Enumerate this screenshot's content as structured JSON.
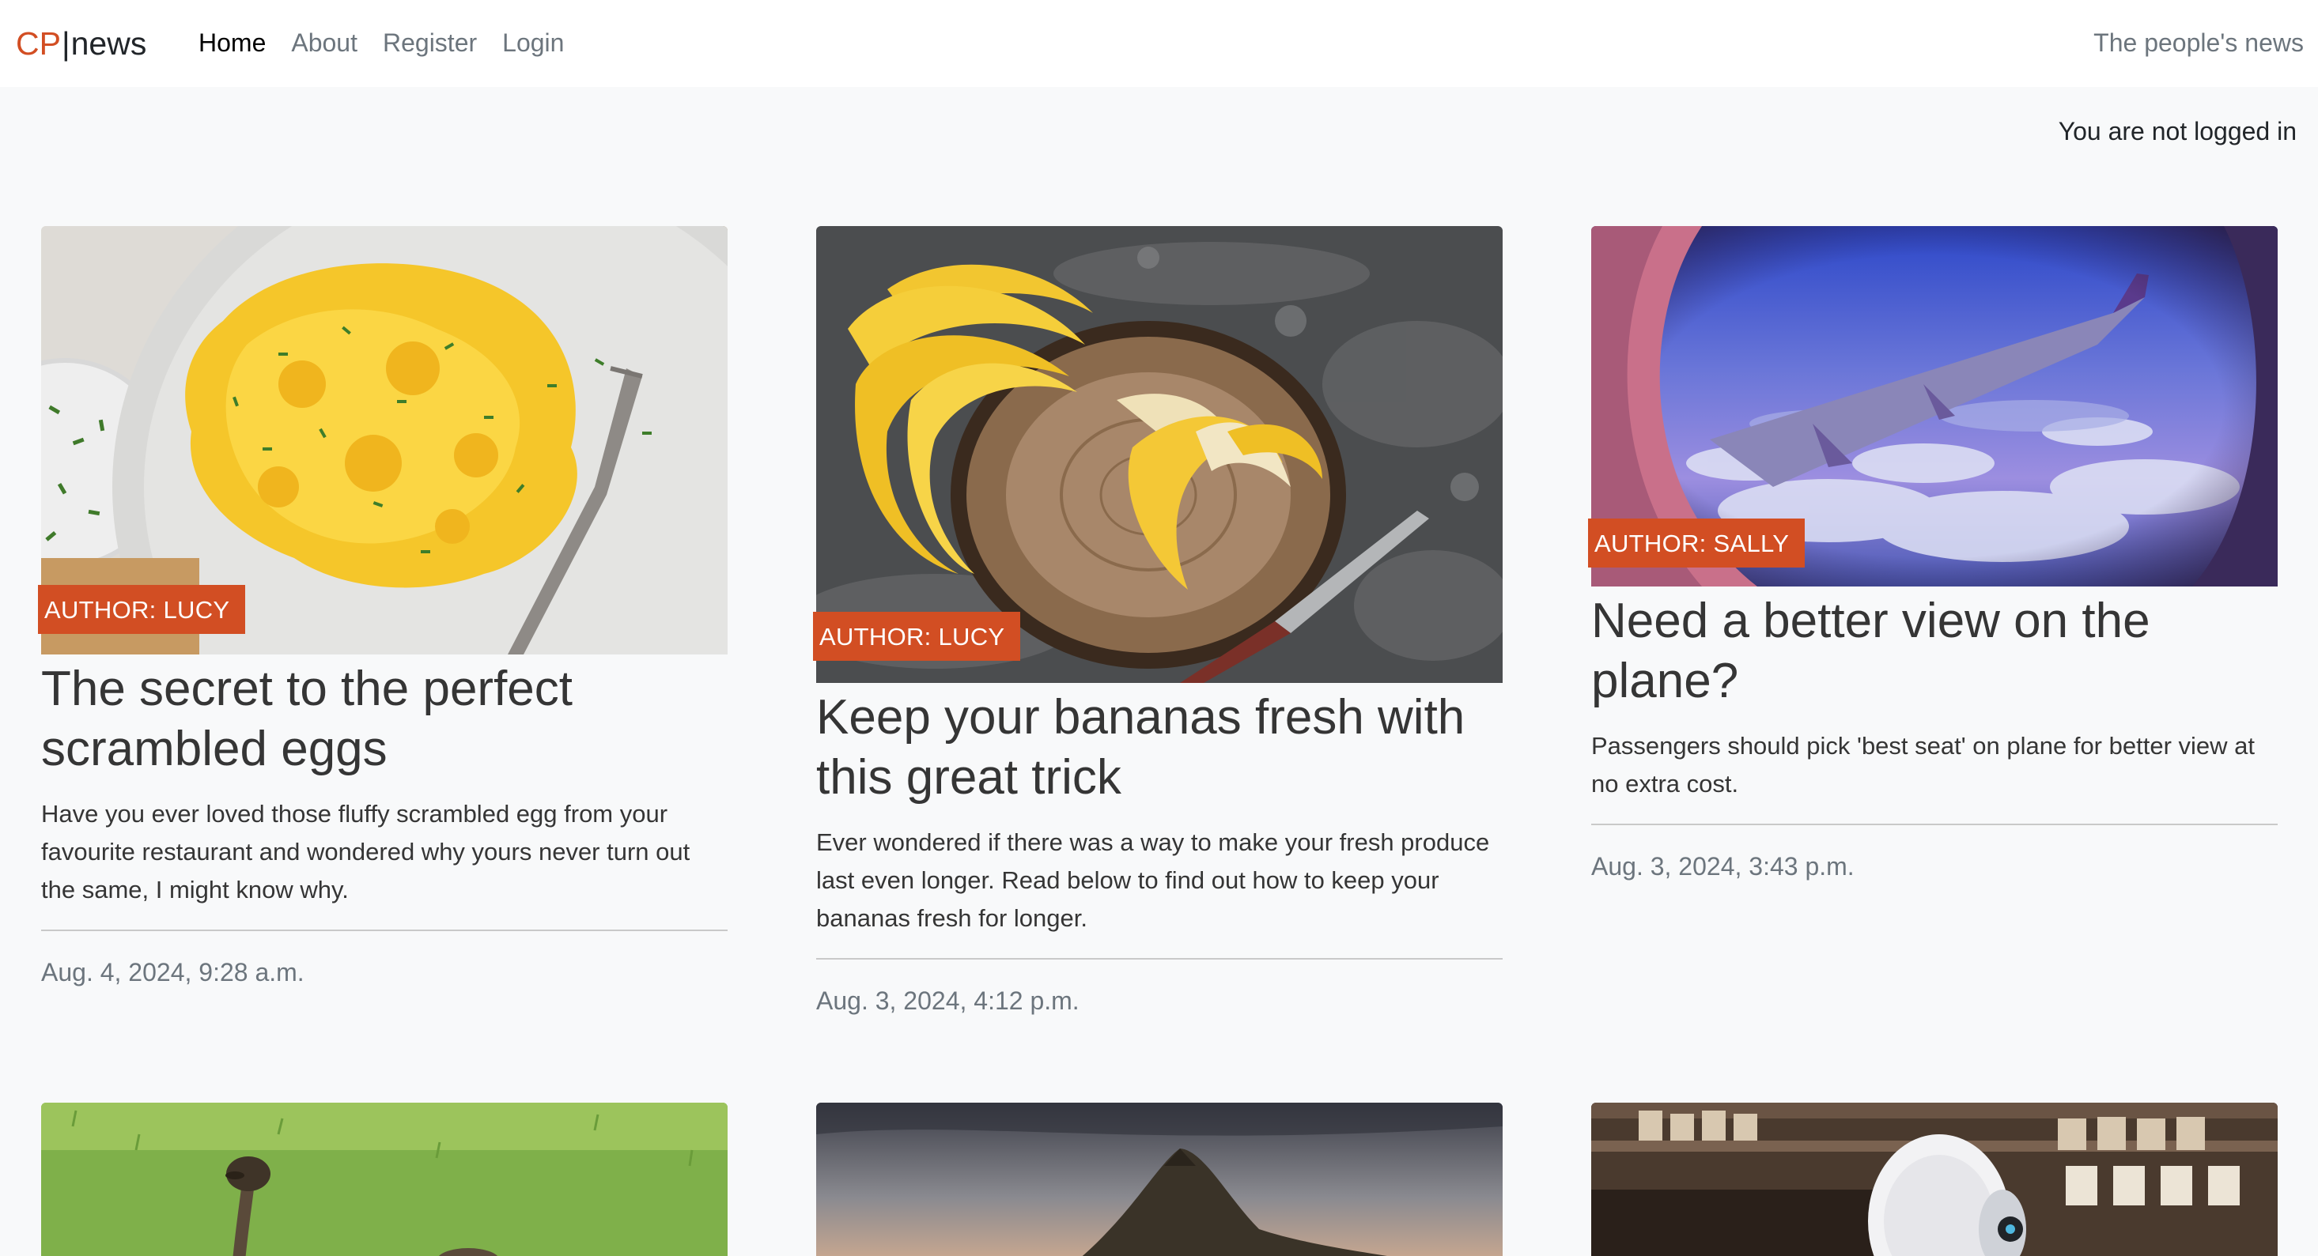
{
  "nav": {
    "brand_cp": "CP",
    "brand_sep": "|",
    "brand_news": "news",
    "links": [
      "Home",
      "About",
      "Register",
      "Login"
    ],
    "tagline": "The people's news"
  },
  "status": "You are not logged in",
  "articles": [
    {
      "author": "AUTHOR: LUCY",
      "title": "The secret to the perfect scrambled eggs",
      "summary": "Have you ever loved those fluffy scrambled egg from your favourite restaurant and wondered why yours never turn out the same, I might know why.",
      "date": "Aug. 4, 2024, 9:28 a.m."
    },
    {
      "author": "AUTHOR: LUCY",
      "title": "Keep your bananas fresh with this great trick",
      "summary": "Ever wondered if there was a way to make your fresh produce last even longer. Read below to find out how to keep your bananas fresh for longer.",
      "date": "Aug. 3, 2024, 4:12 p.m."
    },
    {
      "author": "AUTHOR: SALLY",
      "title": "Need a better view on the plane?",
      "summary": "Passengers should pick 'best seat' on plane for better view at no extra cost.",
      "date": "Aug. 3, 2024, 3:43 p.m."
    }
  ],
  "colors": {
    "accent": "#d24e23",
    "background": "#f8f9fa",
    "muted": "#6c757d"
  }
}
